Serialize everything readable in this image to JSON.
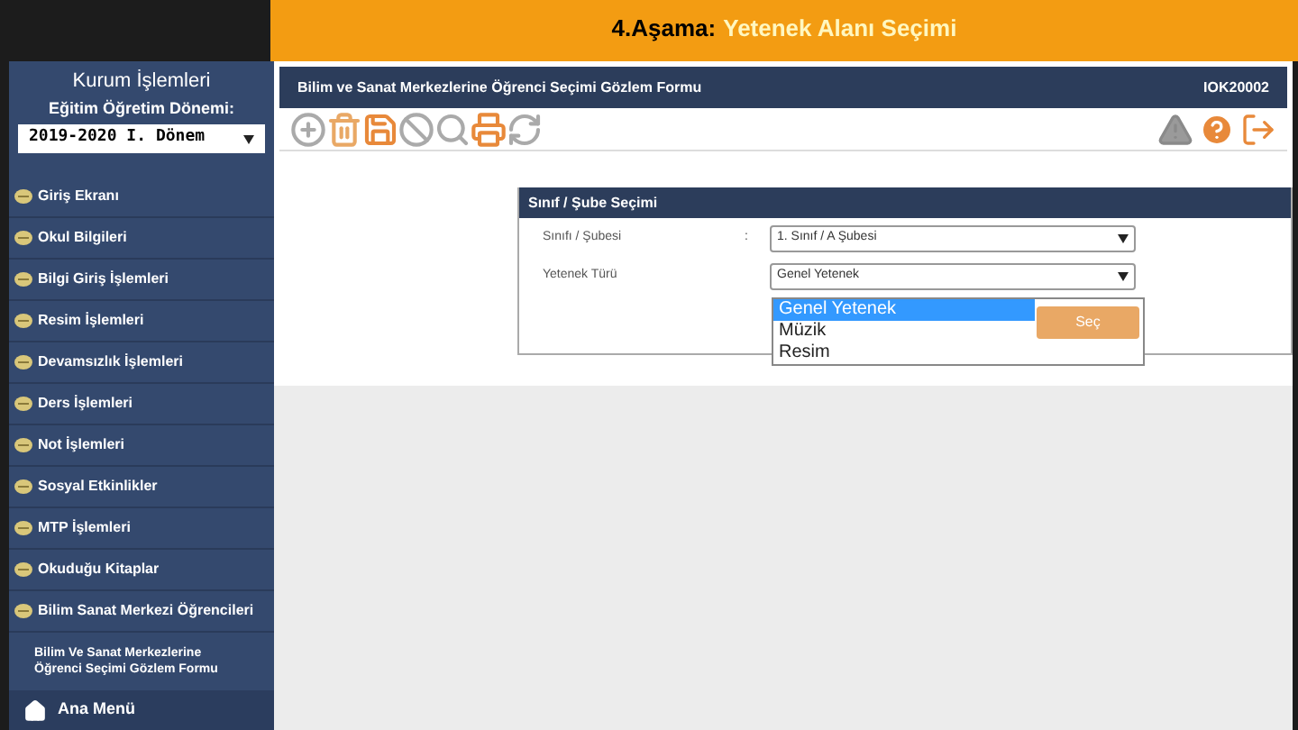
{
  "banner": {
    "step": "4.Aşama:",
    "title": "Yetenek Alanı Seçimi"
  },
  "sidebar": {
    "title": "Kurum İşlemleri",
    "period_label": "Eğitim Öğretim Dönemi:",
    "period_value": "2019-2020 I. Dönem",
    "items": [
      {
        "label": "Giriş Ekranı",
        "kind": "icon"
      },
      {
        "label": "Okul Bilgileri",
        "kind": "icon"
      },
      {
        "label": "Bilgi Giriş İşlemleri",
        "kind": "icon"
      },
      {
        "label": "Resim İşlemleri",
        "kind": "icon"
      },
      {
        "label": "Devamsızlık İşlemleri",
        "kind": "icon"
      },
      {
        "label": "Ders İşlemleri",
        "kind": "icon"
      },
      {
        "label": "Not İşlemleri",
        "kind": "icon"
      },
      {
        "label": "Sosyal Etkinlikler",
        "kind": "icon"
      },
      {
        "label": "MTP İşlemleri",
        "kind": "icon"
      },
      {
        "label": "Okuduğu Kitaplar",
        "kind": "icon"
      },
      {
        "label": "Bilim Sanat Merkezi Öğrencileri",
        "kind": "icon"
      },
      {
        "label": "Bilim Ve Sanat Merkezlerine Öğrenci Seçimi Gözlem Formu",
        "kind": "sub"
      }
    ],
    "home": "Ana Menü"
  },
  "form_header": {
    "title": "Bilim ve Sanat Merkezlerine Öğrenci Seçimi Gözlem Formu",
    "code": "IOK20002"
  },
  "panel": {
    "title": "Sınıf / Şube Seçimi",
    "fields": [
      {
        "label": "Sınıfı / Şubesi",
        "colon": ":",
        "value": "1. Sınıf / A Şubesi"
      },
      {
        "label": "Yetenek Türü",
        "value": "Genel Yetenek"
      }
    ],
    "dropdown": [
      {
        "label": "Genel Yetenek",
        "selected": true
      },
      {
        "label": "Müzik",
        "selected": false
      },
      {
        "label": "Resim",
        "selected": false
      }
    ],
    "button": "Seç"
  }
}
